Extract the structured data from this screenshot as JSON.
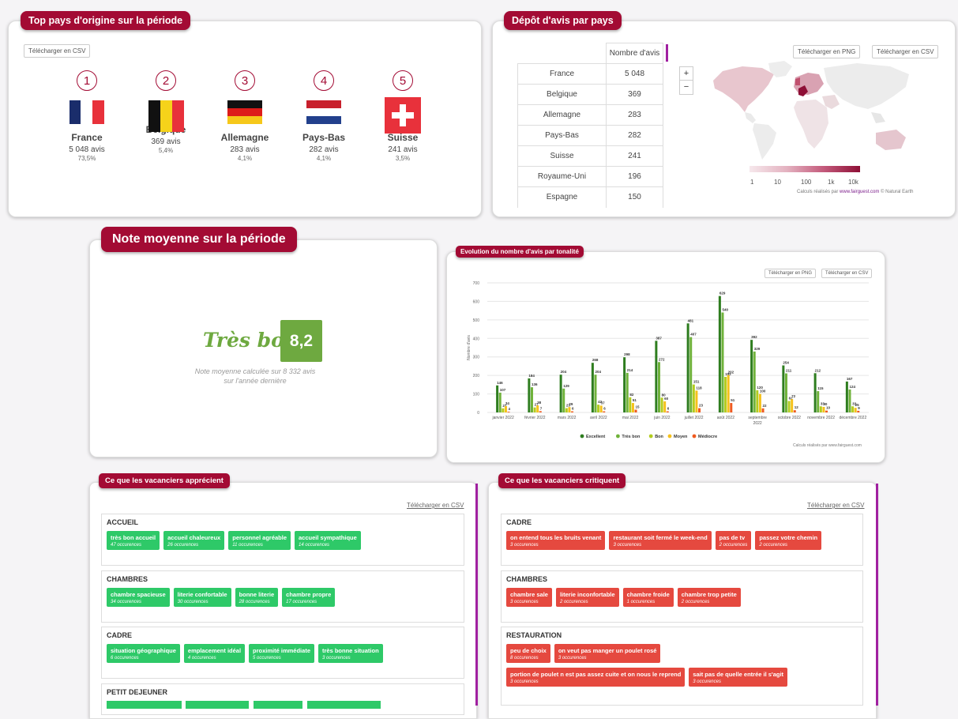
{
  "top_countries": {
    "title": "Top pays d'origine sur la période",
    "download_csv": "Télécharger en CSV",
    "items": [
      {
        "rank": "1",
        "name": "France",
        "reviews": "5 048 avis",
        "percent": "73,5%"
      },
      {
        "rank": "2",
        "name": "Belgique",
        "reviews": "369 avis",
        "percent": "5,4%"
      },
      {
        "rank": "3",
        "name": "Allemagne",
        "reviews": "283 avis",
        "percent": "4,1%"
      },
      {
        "rank": "4",
        "name": "Pays-Bas",
        "reviews": "282 avis",
        "percent": "4,1%"
      },
      {
        "rank": "5",
        "name": "Suisse",
        "reviews": "241 avis",
        "percent": "3,5%"
      }
    ]
  },
  "reviews_by_country": {
    "title": "Dépôt d'avis par pays",
    "column_header": "Nombre d'avis",
    "rows": [
      {
        "country": "France",
        "count": "5 048"
      },
      {
        "country": "Belgique",
        "count": "369"
      },
      {
        "country": "Allemagne",
        "count": "283"
      },
      {
        "country": "Pays-Bas",
        "count": "282"
      },
      {
        "country": "Suisse",
        "count": "241"
      },
      {
        "country": "Royaume-Uni",
        "count": "196"
      },
      {
        "country": "Espagne",
        "count": "150"
      }
    ],
    "download_png": "Télécharger en PNG",
    "download_csv": "Télécharger en CSV",
    "zoom_in": "+",
    "zoom_out": "−",
    "legend_ticks": [
      "1",
      "10",
      "100",
      "1k",
      "10k"
    ],
    "credit_prefix": "Calculs réalisés par ",
    "credit_link": "www.fairguest.com",
    "credit_suffix": " © Natural Earth"
  },
  "average_rating": {
    "title": "Note moyenne sur la période",
    "label": "Très bon",
    "score": "8,2",
    "note_line1": "Note moyenne calculée sur 8 332 avis",
    "note_line2": "sur l'année dernière"
  },
  "tone_chart": {
    "title": "Evolution du nombre d'avis par tonalité",
    "download_png": "Télécharger en PNG",
    "download_csv": "Télécharger en CSV",
    "credit": "Calculs réalisés par www.fairguest.com"
  },
  "chart_data": {
    "type": "bar",
    "title": "",
    "xlabel": "",
    "ylabel": "Nombre d'avis",
    "ylim": [
      0,
      700
    ],
    "yticks": [
      0,
      100,
      200,
      300,
      400,
      500,
      600,
      700
    ],
    "categories": [
      "janvier 2022",
      "février 2022",
      "mars 2022",
      "avril 2022",
      "mai 2022",
      "juin 2022",
      "juillet 2022",
      "août 2022",
      "septembre 2022",
      "octobre 2022",
      "novembre 2022",
      "décembre 2022"
    ],
    "series": [
      {
        "name": "Excellent",
        "color": "#2e7d1f",
        "values": [
          146,
          184,
          204,
          268,
          298,
          387,
          481,
          629,
          392,
          254,
          212,
          167
        ]
      },
      {
        "name": "Très bon",
        "color": "#6fb23a",
        "values": [
          107,
          136,
          129,
          204,
          214,
          272,
          407,
          540,
          329,
          211,
          115,
          124
        ]
      },
      {
        "name": "Bon",
        "color": "#b2cc1f",
        "values": [
          22,
          27,
          23,
          42,
          82,
          80,
          151,
          192,
          120,
          62,
          33,
          33
        ]
      },
      {
        "name": "Moyen",
        "color": "#f5c11b",
        "values": [
          34,
          38,
          29,
          37,
          51,
          60,
          118,
          202,
          100,
          72,
          30,
          25
        ]
      },
      {
        "name": "Médiocre",
        "color": "#ef5a1f",
        "values": [
          4,
          7,
          6,
          6,
          15,
          6,
          23,
          51,
          22,
          12,
          10,
          9
        ]
      }
    ]
  },
  "likes": {
    "title": "Ce que les vacanciers apprécient",
    "download_csv": "Télécharger en CSV",
    "groups": [
      {
        "name": "ACCUEIL",
        "tags": [
          {
            "label": "très bon accueil",
            "occ": "47 occurences"
          },
          {
            "label": "accueil chaleureux",
            "occ": "26 occurences"
          },
          {
            "label": "personnel agréable",
            "occ": "11 occurences"
          },
          {
            "label": "accueil sympathique",
            "occ": "14 occurences"
          }
        ]
      },
      {
        "name": "CHAMBRES",
        "tags": [
          {
            "label": "chambre spacieuse",
            "occ": "34 occurences"
          },
          {
            "label": "literie confortable",
            "occ": "30 occurences"
          },
          {
            "label": "bonne literie",
            "occ": "28 occurences"
          },
          {
            "label": "chambre propre",
            "occ": "17 occurences"
          }
        ]
      },
      {
        "name": "CADRE",
        "tags": [
          {
            "label": "situation géographique",
            "occ": "6 occurences"
          },
          {
            "label": "emplacement idéal",
            "occ": "4 occurences"
          },
          {
            "label": "proximité immédiate",
            "occ": "5 occurences"
          },
          {
            "label": "très bonne situation",
            "occ": "3 occurences"
          }
        ]
      },
      {
        "name": "PETIT DEJEUNER",
        "tags": []
      }
    ]
  },
  "critics": {
    "title": "Ce que les vacanciers critiquent",
    "download_csv": "Télécharger en CSV",
    "groups": [
      {
        "name": "CADRE",
        "tags": [
          {
            "label": "on entend tous les bruits venant",
            "occ": "3 occurences"
          },
          {
            "label": "restaurant soit fermé le week-end",
            "occ": "3 occurences"
          },
          {
            "label": "pas de tv",
            "occ": "2 occurences"
          },
          {
            "label": "passez votre chemin",
            "occ": "2 occurences"
          }
        ]
      },
      {
        "name": "CHAMBRES",
        "tags": [
          {
            "label": "chambre sale",
            "occ": "3 occurences"
          },
          {
            "label": "literie inconfortable",
            "occ": "2 occurences"
          },
          {
            "label": "chambre froide",
            "occ": "1 occurences"
          },
          {
            "label": "chambre trop petite",
            "occ": "2 occurences"
          }
        ]
      },
      {
        "name": "RESTAURATION",
        "tags": [
          {
            "label": "peu de choix",
            "occ": "8 occurences"
          },
          {
            "label": "on veut pas manger un poulet rosé",
            "occ": "3 occurences"
          }
        ],
        "tags2": [
          {
            "label": "portion de poulet n est pas assez cuite et on nous le reprend",
            "occ": "3 occurences"
          },
          {
            "label": "sait pas de quelle entrée il s'agit",
            "occ": "3 occurences"
          }
        ]
      }
    ]
  }
}
